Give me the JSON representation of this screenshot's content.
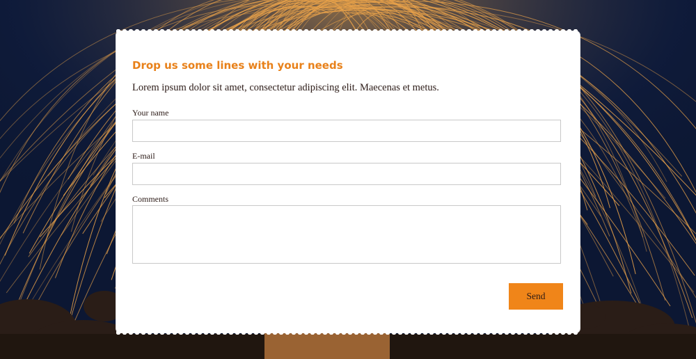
{
  "form": {
    "heading": "Drop us some lines with your needs",
    "intro": "Lorem ipsum dolor sit amet, consectetur adipiscing elit. Maecenas et metus.",
    "name_label": "Your name",
    "name_value": "",
    "email_label": "E-mail",
    "email_value": "",
    "comments_label": "Comments",
    "comments_value": "",
    "send_label": "Send"
  },
  "colors": {
    "accent": "#f08519",
    "heading": "#e8811a",
    "text": "#2b1a16",
    "sky": "#0b1630"
  }
}
